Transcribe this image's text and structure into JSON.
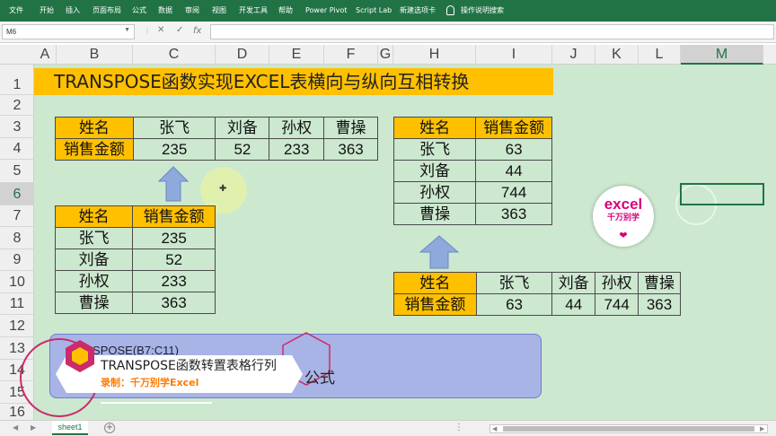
{
  "ribbon": {
    "tabs": [
      "文件",
      "开始",
      "插入",
      "页面布局",
      "公式",
      "数据",
      "审阅",
      "视图",
      "开发工具",
      "帮助",
      "Power Pivot",
      "Script Lab",
      "新建选项卡"
    ],
    "search_label": "操作说明搜索",
    "color": "#217346"
  },
  "formula_bar": {
    "name_box": "M6",
    "cancel_icon": "close-icon",
    "enter_icon": "check-icon",
    "fx_label": "fx",
    "content": ""
  },
  "columns": [
    "A",
    "B",
    "C",
    "D",
    "E",
    "F",
    "G",
    "H",
    "I",
    "J",
    "K",
    "L",
    "M"
  ],
  "rows": [
    "1",
    "2",
    "3",
    "4",
    "5",
    "6",
    "7",
    "8",
    "9",
    "10",
    "11",
    "12",
    "13",
    "14",
    "15",
    "16"
  ],
  "selected": {
    "cell": "M6",
    "column": "M",
    "row": "6"
  },
  "title": "TRANSPOSE函数实现EXCEL表横向与纵向互相转换",
  "table_horizontal": {
    "row1": [
      "姓名",
      "张飞",
      "刘备",
      "孙权",
      "曹操"
    ],
    "row2": [
      "销售金额",
      "235",
      "52",
      "233",
      "363"
    ]
  },
  "table_vertical": {
    "header": [
      "姓名",
      "销售金额"
    ],
    "rows": [
      [
        "张飞",
        "235"
      ],
      [
        "刘备",
        "52"
      ],
      [
        "孙权",
        "233"
      ],
      [
        "曹操",
        "363"
      ]
    ]
  },
  "table_vertical_right": {
    "header": [
      "姓名",
      "销售金额"
    ],
    "rows": [
      [
        "张飞",
        "63"
      ],
      [
        "刘备",
        "44"
      ],
      [
        "孙权",
        "744"
      ],
      [
        "曹操",
        "363"
      ]
    ]
  },
  "table_horizontal_right": {
    "row1": [
      "姓名",
      "张飞",
      "刘备",
      "孙权",
      "曹操"
    ],
    "row2": [
      "销售金额",
      "63",
      "44",
      "744",
      "363"
    ]
  },
  "logo": {
    "text": "excel",
    "subtitle": "千万别学",
    "heart_icon": "heart-icon"
  },
  "banner": {
    "formula": "=TRANSPOSE(B7:C11)",
    "formula_visible": "ANSPOSE(B7:C11)",
    "word": "公式"
  },
  "overlay_card": {
    "title": "TRANSPOSE函数转置表格行列",
    "subtitle": "录制：千万别学Excel"
  },
  "sheet_tabs": [
    "sheet1"
  ],
  "colors": {
    "header_fill": "#ffc000",
    "sheet_bg": "#cce8cf",
    "arrow": "#8ea9db",
    "banner": "#a8b4e6",
    "accent": "#cc2a6a"
  }
}
